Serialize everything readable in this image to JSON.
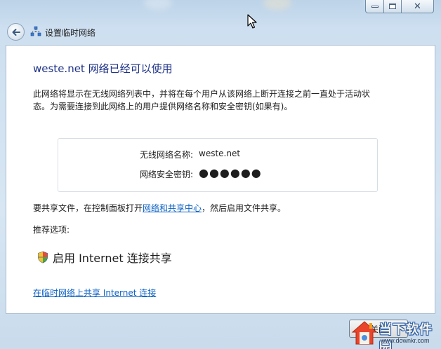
{
  "window": {
    "caption": {
      "minimize": "minimize",
      "maximize": "maximize",
      "close": "close"
    }
  },
  "nav": {
    "title": "设置临时网络",
    "icon": "network-icon",
    "back_icon": "back-arrow-icon"
  },
  "content": {
    "heading": "weste.net 网络已经可以使用",
    "description": "此网络将显示在无线网络列表中，并将在每个用户从该网络上断开连接之前一直处于活动状态。为需要连接到此网络上的用户提供网络名称和安全密钥(如果有)。",
    "network_name_label": "无线网络名称:",
    "network_name_value": "weste.net",
    "security_key_label": "网络安全密钥:",
    "security_key_value": "●●●●●●",
    "share_text_before": "要共享文件，在控制面板打开",
    "share_link": "网络和共享中心",
    "share_text_after": "，然后启用文件共享。",
    "recommended_label": "推荐选项:",
    "ics_option": "启用 Internet 连接共享",
    "ics_option_icon": "shield-icon",
    "share_internet_link": "在临时网络上共享 Internet 连接"
  },
  "footer": {
    "close_label": "关闭"
  },
  "watermark": {
    "title": "当下软件园",
    "url": "www.downkr.com"
  },
  "colors": {
    "heading": "#1e3287",
    "link": "#0c62c4",
    "frame": "#cddff0"
  }
}
